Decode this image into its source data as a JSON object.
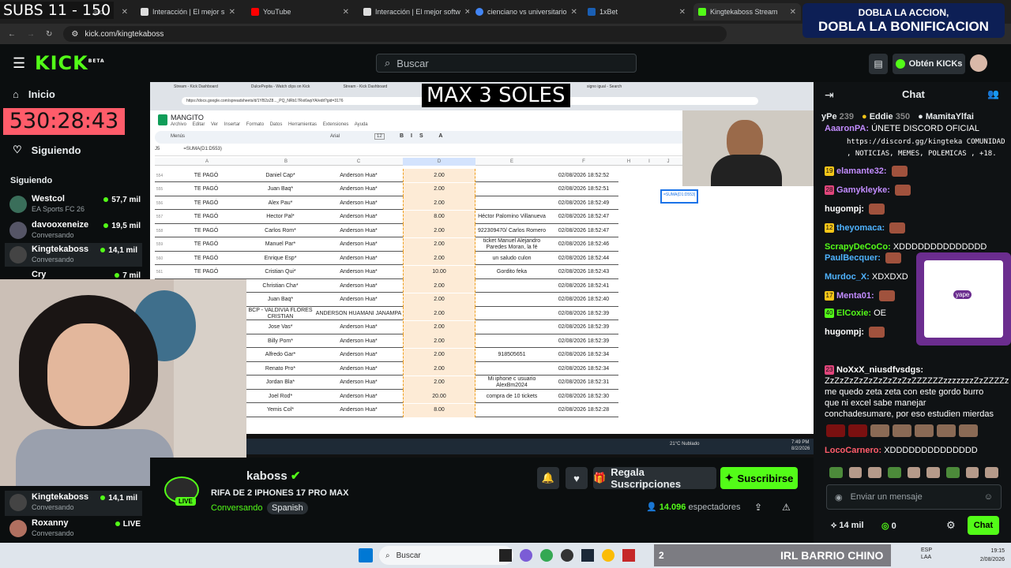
{
  "overlay": {
    "subs": "SUBS 11 - 150",
    "max": "MAX 3 SOLES",
    "timer": "530:28:43",
    "promo_line1": "DOBLA LA ACCION,",
    "promo_line2": "DOBLA LA BONIFICACION",
    "barrio": "IRL BARRIO CHINO",
    "scene_num": "2"
  },
  "browser": {
    "tabs": [
      {
        "label": "ard"
      },
      {
        "label": "Interacción | El mejor s"
      },
      {
        "label": "YouTube"
      },
      {
        "label": "Interacción | El mejor softw"
      },
      {
        "label": "cienciano vs universitario"
      },
      {
        "label": "1xBet"
      },
      {
        "label": "Kingtekaboss Stream"
      }
    ],
    "url": "kick.com/kingtekaboss"
  },
  "kick": {
    "logo": "KICK",
    "logo_sup": "BETA",
    "search_placeholder": "Buscar",
    "get_kicks": "Obtén KICKs"
  },
  "sidebar": {
    "home": "Inicio",
    "following": "Siguiendo",
    "section": "Siguiendo",
    "channels": [
      {
        "name": "Westcol",
        "sub": "EA Sports FC 26",
        "viewers": "57,7 mil"
      },
      {
        "name": "davooxeneize",
        "sub": "Conversando",
        "viewers": "19,5 mil"
      },
      {
        "name": "Kingtekaboss",
        "sub": "Conversando",
        "viewers": "14,1 mil"
      },
      {
        "name": "Cry",
        "sub": "",
        "viewers": "7 mil"
      }
    ],
    "bottom": [
      {
        "name": "Kingtekaboss",
        "sub": "Conversando",
        "viewers": "14,1 mil"
      },
      {
        "name": "Roxanny",
        "sub": "Conversando",
        "viewers": "LIVE"
      }
    ]
  },
  "sheet": {
    "title": "MANGITO",
    "menu": "Archivo Editar Ver Insertar Formato Datos Herramientas Extensiones Ayuda",
    "formula": "=SUMA(D1:D553)",
    "cell": "J5",
    "font": "Arial",
    "fontsize": "12",
    "zoom": "Menús",
    "inner_tabs": [
      "Stream - Kick Dashboard",
      "DulcePepita - Watch clips on Kick",
      "Stream - Kick Dashboard",
      "signo igual - Search"
    ],
    "inner_url": "https://docs.google.com/spreadsheets/d/1YB2zZ8..._PQ_NRb17Rxi6wpYA/edit?gid=3176",
    "columns": [
      "A",
      "B",
      "C",
      "D",
      "E",
      "F",
      "H",
      "I",
      "J"
    ],
    "rows": [
      {
        "n": "554",
        "a": "TE PAGÓ",
        "b": "Daniel Cap*",
        "c": "Anderson Hua*",
        "d": "2.00",
        "e": "",
        "f": "02/08/2026 18:52:52"
      },
      {
        "n": "555",
        "a": "TE PAGÓ",
        "b": "Juan Baq*",
        "c": "Anderson Hua*",
        "d": "2.00",
        "e": "",
        "f": "02/08/2026 18:52:51"
      },
      {
        "n": "556",
        "a": "TE PAGÓ",
        "b": "Alex Pau*",
        "c": "Anderson Hua*",
        "d": "2.00",
        "e": "",
        "f": "02/08/2026 18:52:49"
      },
      {
        "n": "557",
        "a": "TE PAGÓ",
        "b": "Hector Pal*",
        "c": "Anderson Hua*",
        "d": "8.00",
        "e": "Héctor Palomino Villanueva",
        "f": "02/08/2026 18:52:47"
      },
      {
        "n": "558",
        "a": "TE PAGÓ",
        "b": "Carlos Rom*",
        "c": "Anderson Hua*",
        "d": "2.00",
        "e": "922309470/ Carlos Romero",
        "f": "02/08/2026 18:52:47"
      },
      {
        "n": "559",
        "a": "TE PAGÓ",
        "b": "Manuel Par*",
        "c": "Anderson Hua*",
        "d": "2.00",
        "e": "ticket  Manuel Alejandro Paredes Moran, la fé",
        "f": "02/08/2026 18:52:46"
      },
      {
        "n": "560",
        "a": "TE PAGÓ",
        "b": "Enrique Esp*",
        "c": "Anderson Hua*",
        "d": "2.00",
        "e": "un saludo culon",
        "f": "02/08/2026 18:52:44"
      },
      {
        "n": "561",
        "a": "TE PAGÓ",
        "b": "Cristian Qui*",
        "c": "Anderson Hua*",
        "d": "10.00",
        "e": "Gordito feka",
        "f": "02/08/2026 18:52:43"
      },
      {
        "n": "562",
        "a": "",
        "b": "Christian Cha*",
        "c": "Anderson Hua*",
        "d": "2.00",
        "e": "",
        "f": "02/08/2026 18:52:41"
      },
      {
        "n": "563",
        "a": "",
        "b": "Juan Baq*",
        "c": "Anderson Hua*",
        "d": "2.00",
        "e": "",
        "f": "02/08/2026 18:52:40"
      },
      {
        "n": "564",
        "a": "",
        "b": "BCP - VALDIVIA FLORES CRISTIAN",
        "c": "ANDERSON HUAMANI JANAMPA",
        "d": "2.00",
        "e": "",
        "f": "02/08/2026 18:52:39"
      },
      {
        "n": "565",
        "a": "",
        "b": "Jose Vas*",
        "c": "Anderson Hua*",
        "d": "2.00",
        "e": "",
        "f": "02/08/2026 18:52:39"
      },
      {
        "n": "566",
        "a": "",
        "b": "Billy Pom*",
        "c": "Anderson Hua*",
        "d": "2.00",
        "e": "",
        "f": "02/08/2026 18:52:39"
      },
      {
        "n": "567",
        "a": "",
        "b": "Alfredo Gar*",
        "c": "Anderson Hua*",
        "d": "2.00",
        "e": "918505651",
        "f": "02/08/2026 18:52:34"
      },
      {
        "n": "568",
        "a": "",
        "b": "Renato Pro*",
        "c": "Anderson Hua*",
        "d": "2.00",
        "e": "",
        "f": "02/08/2026 18:52:34"
      },
      {
        "n": "569",
        "a": "",
        "b": "Jordan Bla*",
        "c": "Anderson Hua*",
        "d": "2.00",
        "e": "Mi iphone c  usuario AlexBm2024",
        "f": "02/08/2026 18:52:31"
      },
      {
        "n": "570",
        "a": "",
        "b": "Joel Rod*",
        "c": "Anderson Hua*",
        "d": "20.00",
        "e": "compra de 10 tickets",
        "f": "02/08/2026 18:52:30"
      },
      {
        "n": "571",
        "a": "",
        "b": "Yemis Col*",
        "c": "Anderson Hua*",
        "d": "8.00",
        "e": "",
        "f": "02/08/2026 18:52:28"
      }
    ],
    "inner_weather": "21°C Nublado",
    "inner_time": "7:49 PM",
    "inner_date": "8/2/2026"
  },
  "stream": {
    "channel": "kaboss",
    "title": "RIFA DE 2 IPHONES 17 PRO MAX",
    "category": "Conversando",
    "language": "Spanish",
    "live": "LIVE",
    "viewers": "14.096",
    "viewers_label": "espectadores",
    "gift_btn": "Regala Suscripciones",
    "sub_btn": "Suscribirse"
  },
  "chat": {
    "header": "Chat",
    "leaderboard": [
      {
        "name": "yPe",
        "score": "239"
      },
      {
        "name": "Eddie",
        "score": "350"
      },
      {
        "name": "MamitaYlfai",
        "score": ""
      }
    ],
    "messages": [
      {
        "user": "AaaronPA:",
        "text": "ÚNETE DISCORD OFICIAL"
      },
      {
        "user": "",
        "text": "https://discord.gg/kingteka COMUNIDAD , NOTICIAS, MEMES, POLEMICAS , +18."
      },
      {
        "badge": "19",
        "user": "elamante32:",
        "text": ""
      },
      {
        "badge": "28",
        "user": "Gamykleyke:",
        "text": ""
      },
      {
        "user": "hugompj:",
        "text": ""
      },
      {
        "badge": "12",
        "user": "theyomaca:",
        "text": ""
      },
      {
        "user": "ScrapyDeCoCo:",
        "text": "XDDDDDDDDDDDDDD"
      },
      {
        "user": "PaulBecquer:",
        "text": ""
      },
      {
        "user": "Murdoc_X:",
        "text": "XDXDXD"
      },
      {
        "badge": "17",
        "user": "Menta01:",
        "text": ""
      },
      {
        "badge": "40",
        "user": "ElCoxie:",
        "text": "OE"
      },
      {
        "user": "hugompj:",
        "text": ""
      },
      {
        "badge": "23",
        "user": "NoXxX_niusdfvsdgs:",
        "text": "ZzZzZzZzZzZzZzZzZzZZZZZZzzzzzzzZzZZZZz me quedo zeta zeta con este gordo burro que ni excel sabe manejar conchadesumare, por eso estudien mierdas"
      },
      {
        "user": "LocoCarnero:",
        "text": "XDDDDDDDDDDDDDD"
      }
    ],
    "input_placeholder": "Enviar un mensaje",
    "kicks_count": "14 mil",
    "zero": "0",
    "send": "Chat",
    "qr_label": "yape"
  },
  "taskbar": {
    "search": "Buscar",
    "lang": "ESP",
    "lang2": "LAA",
    "time": "19:15",
    "date": "2/08/2026"
  },
  "colors": {
    "accent": "#53fc18",
    "timer_bg": "#ff5c6a"
  }
}
